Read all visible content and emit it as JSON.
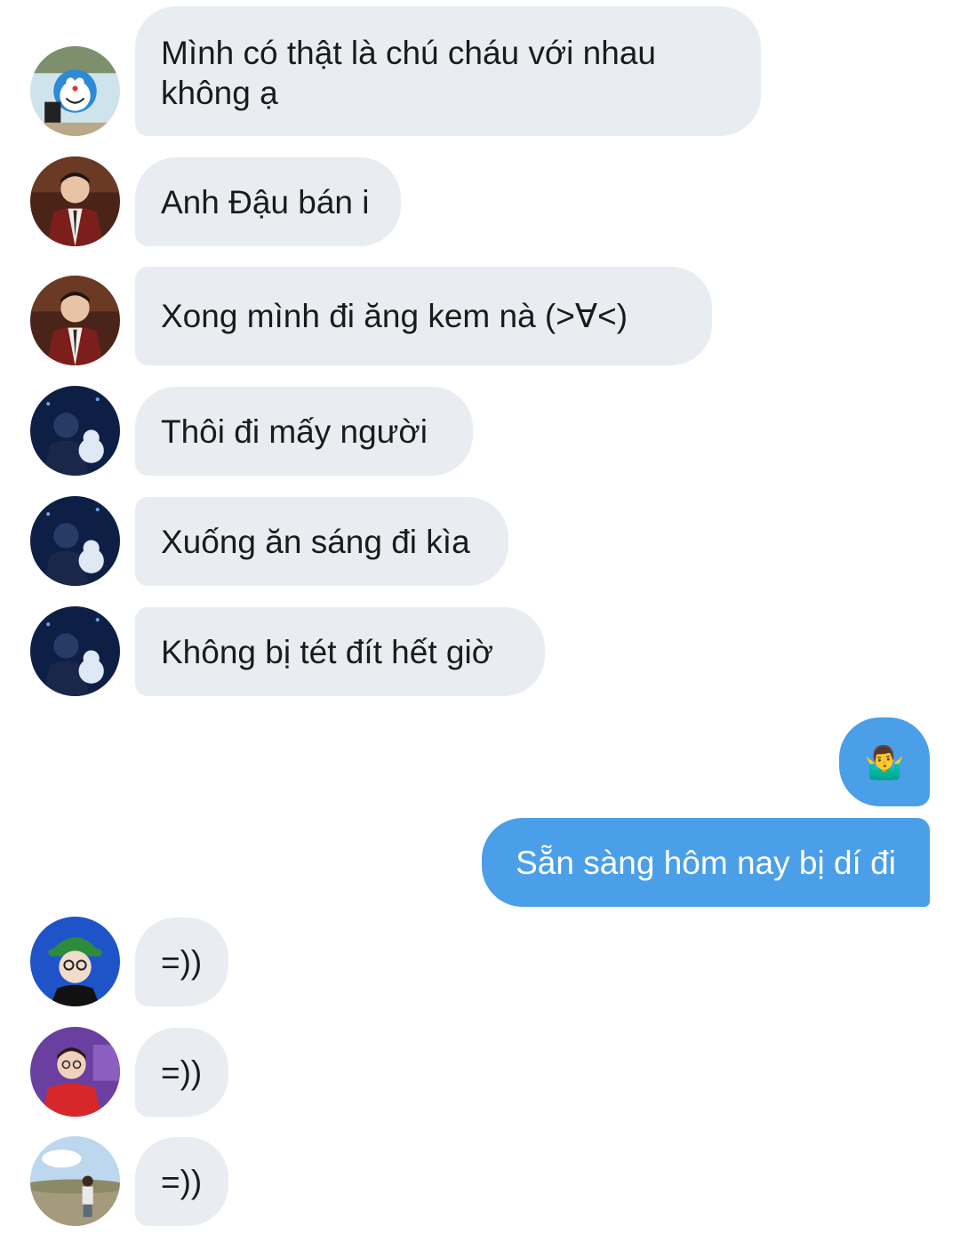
{
  "messages": [
    {
      "direction": "incoming",
      "sender_avatar": "doraemon-avatar",
      "text": "Mình có thật là chú cháu với nhau không ạ"
    },
    {
      "direction": "incoming",
      "sender_avatar": "plaid-suit-avatar",
      "text": "Anh Đậu bán i"
    },
    {
      "direction": "incoming",
      "sender_avatar": "plaid-suit-avatar",
      "text": "Xong mình đi ăng kem nà (>∀<)"
    },
    {
      "direction": "incoming",
      "sender_avatar": "blue-night-avatar",
      "text": "Thôi đi mấy người"
    },
    {
      "direction": "incoming",
      "sender_avatar": "blue-night-avatar",
      "text": "Xuống ăn sáng đi kìa"
    },
    {
      "direction": "incoming",
      "sender_avatar": "blue-night-avatar",
      "text": "Không bị tét đít hết giờ"
    },
    {
      "direction": "outgoing",
      "text": "🤷‍♂️"
    },
    {
      "direction": "outgoing",
      "text": "Sẵn sàng hôm nay bị dí đi"
    },
    {
      "direction": "incoming",
      "sender_avatar": "green-hat-avatar",
      "text": "=))"
    },
    {
      "direction": "incoming",
      "sender_avatar": "red-jacket-avatar",
      "text": "=))"
    },
    {
      "direction": "incoming",
      "sender_avatar": "field-photo-avatar",
      "text": "=))"
    }
  ],
  "colors": {
    "incoming_bubble": "#e9edf1",
    "outgoing_bubble": "#4a9fe8",
    "incoming_text": "#1b1b1b",
    "outgoing_text": "#ffffff",
    "background": "#ffffff"
  }
}
